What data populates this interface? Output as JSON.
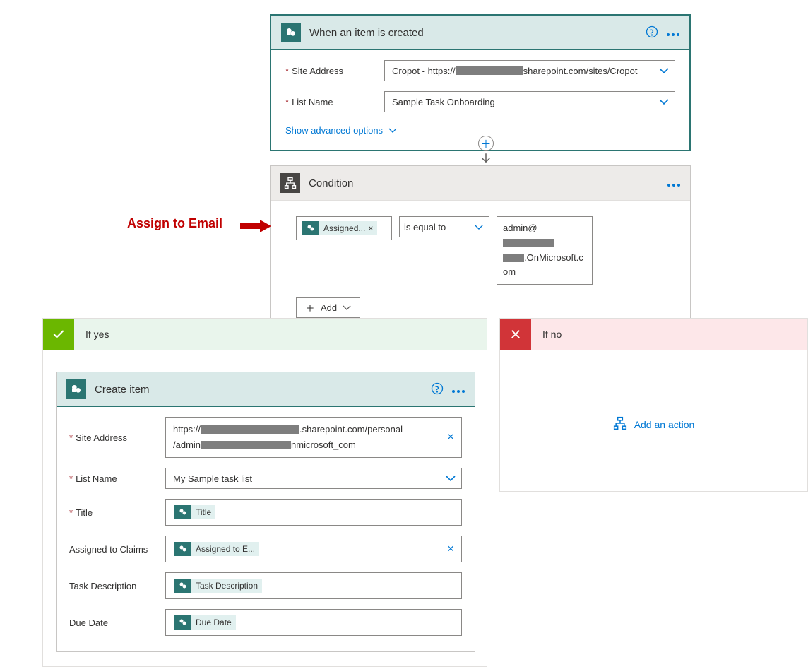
{
  "trigger": {
    "title": "When an item is created",
    "fields": {
      "siteAddress": {
        "label": "Site Address",
        "value_pre": "Cropot - https://",
        "value_post": "sharepoint.com/sites/Cropot"
      },
      "listName": {
        "label": "List Name",
        "value": "Sample Task Onboarding"
      }
    },
    "advanced": "Show advanced options"
  },
  "condition": {
    "title": "Condition",
    "left_token": "Assigned...",
    "operator": "is equal to",
    "right_pre": "admin@",
    "right_mid": ".OnMicrosoft.c",
    "right_end": "om",
    "add": "Add"
  },
  "annotation": "Assign to Email",
  "branches": {
    "yes": "If yes",
    "no": "If no",
    "add_action": "Add an action"
  },
  "create": {
    "title": "Create item",
    "fields": {
      "siteAddress": {
        "label": "Site Address",
        "line1_pre": "https://",
        "line1_post": ".sharepoint.com/personal",
        "line2_pre": "/admin",
        "line2_post": "nmicrosoft_com"
      },
      "listName": {
        "label": "List Name",
        "value": "My Sample task list"
      },
      "title": {
        "label": "Title",
        "token": "Title"
      },
      "assigned": {
        "label": "Assigned to Claims",
        "token": "Assigned to E..."
      },
      "taskDesc": {
        "label": "Task Description",
        "token": "Task Description"
      },
      "dueDate": {
        "label": "Due Date",
        "token": "Due Date"
      }
    }
  }
}
